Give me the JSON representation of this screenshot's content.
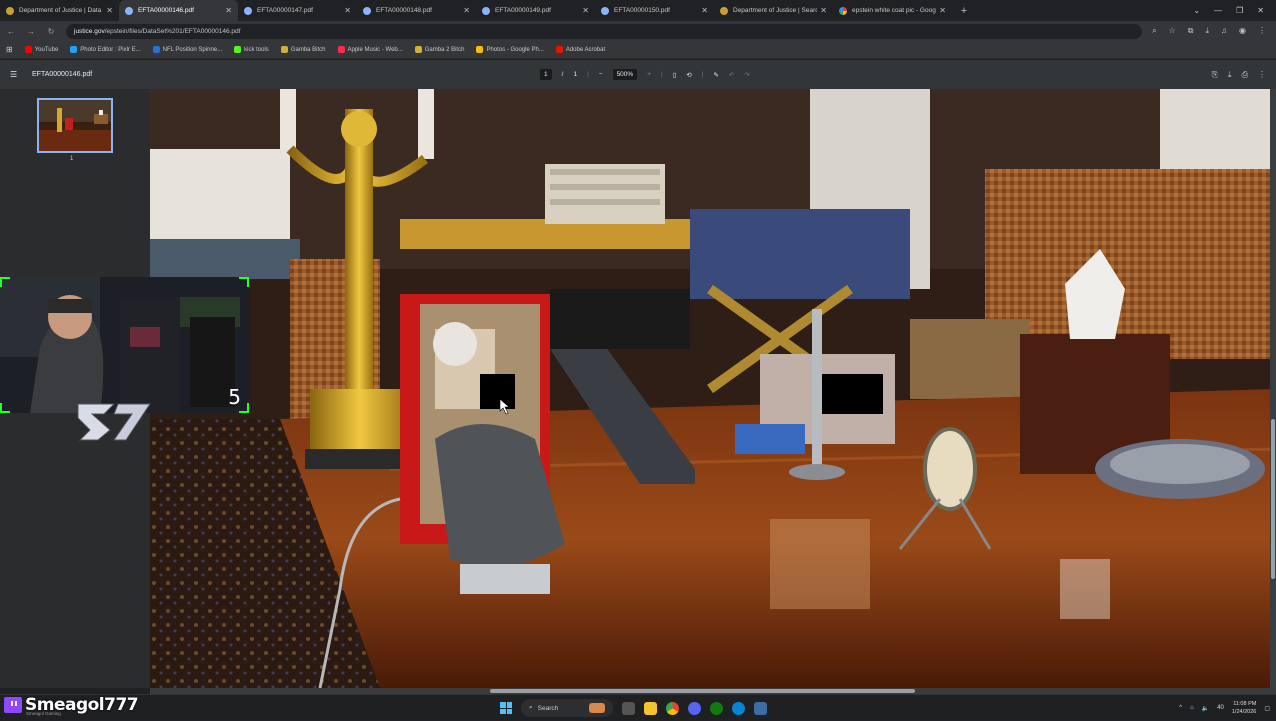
{
  "browser": {
    "tabs": [
      {
        "title": "Department of Justice | Data S",
        "favicon": "doj",
        "active": false
      },
      {
        "title": "EFTA00000146.pdf",
        "favicon": "pdf",
        "active": true
      },
      {
        "title": "EFTA00000147.pdf",
        "favicon": "pdf",
        "active": false
      },
      {
        "title": "EFTA00000148.pdf",
        "favicon": "pdf",
        "active": false
      },
      {
        "title": "EFTA00000149.pdf",
        "favicon": "pdf",
        "active": false
      },
      {
        "title": "EFTA00000150.pdf",
        "favicon": "pdf",
        "active": false
      },
      {
        "title": "Department of Justice | Search",
        "favicon": "doj",
        "active": false
      },
      {
        "title": "epstein white coat pic - Googl",
        "favicon": "google",
        "active": false
      }
    ],
    "url_domain": "justice.gov",
    "url_path": "/epstein/files/DataSet%201/EFTA00000146.pdf",
    "bookmarks": [
      {
        "label": "YouTube",
        "color": "#ff0000"
      },
      {
        "label": "Photo Editor : Pixlr E...",
        "color": "#1fa3ff"
      },
      {
        "label": "NFL Position Spinne...",
        "color": "#2a6fd6"
      },
      {
        "label": "kick tools",
        "color": "#53fc18"
      },
      {
        "label": "Gamba Bitch",
        "color": "#d4af37"
      },
      {
        "label": "Apple Music - Web...",
        "color": "#fa2d48"
      },
      {
        "label": "Gamba 2 Bitch",
        "color": "#d4af37"
      },
      {
        "label": "Photos - Google Ph...",
        "color": "#fbbc05"
      },
      {
        "label": "Adobe Acrobat",
        "color": "#eb1000"
      }
    ]
  },
  "pdf_viewer": {
    "filename": "EFTA00000146.pdf",
    "current_page": "1",
    "page_separator": "/",
    "total_pages": "1",
    "zoom": "500%",
    "thumbnail_page": "1"
  },
  "overlay": {
    "webcam_counter": "5",
    "streamer_name": "Smeagol777",
    "streamer_sub": "Smeagol Gaming"
  },
  "taskbar": {
    "search_placeholder": "Search",
    "time": "11:08 PM",
    "date": "1/24/2026",
    "volume_label": "40"
  }
}
